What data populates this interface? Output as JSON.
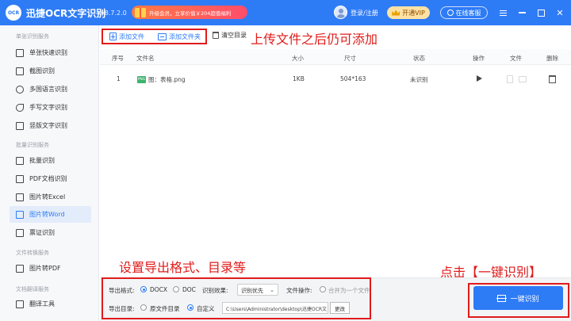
{
  "titlebar": {
    "logo": "OCR",
    "title": "迅捷OCR文字识别",
    "version": "v8.7.2.0",
    "promo": "升级会员，立享价值￥204超值福利",
    "login": "登录/注册",
    "vip": "开通VIP",
    "service": "在线客服"
  },
  "sidebar": {
    "groups": [
      {
        "title": "单张识别服务",
        "items": [
          {
            "label": "单张快速识别",
            "icon": "image-icon"
          },
          {
            "label": "截图识别",
            "icon": "crop-icon"
          },
          {
            "label": "多国语言识别",
            "icon": "globe-icon"
          },
          {
            "label": "手写文字识别",
            "icon": "pen-icon"
          },
          {
            "label": "竖版文字识别",
            "icon": "vertical-text-icon"
          }
        ]
      },
      {
        "title": "批量识别服务",
        "items": [
          {
            "label": "批量识别",
            "icon": "batch-icon"
          },
          {
            "label": "PDF文档识别",
            "icon": "pdf-icon"
          },
          {
            "label": "图片转Excel",
            "icon": "excel-icon"
          },
          {
            "label": "图片转Word",
            "icon": "word-icon",
            "active": true
          },
          {
            "label": "票证识别",
            "icon": "ticket-icon"
          }
        ]
      },
      {
        "title": "文件转换服务",
        "items": [
          {
            "label": "图片转PDF",
            "icon": "pdf-convert-icon"
          }
        ]
      },
      {
        "title": "文档翻译服务",
        "items": [
          {
            "label": "翻译工具",
            "icon": "translate-icon"
          }
        ]
      }
    ]
  },
  "toolbar": {
    "add_file": "添加文件",
    "add_folder": "添加文件夹",
    "clear": "清空目录"
  },
  "annotations": {
    "top": "上传文件之后仍可添加",
    "bottom": "设置导出格式、目录等",
    "right": "点击【一键识别】"
  },
  "table": {
    "headers": [
      "序号",
      "文件名",
      "大小",
      "尺寸",
      "状态",
      "操作",
      "文件",
      "删除"
    ],
    "rows": [
      {
        "index": "1",
        "name": "图：表格.png",
        "size": "1KB",
        "dimensions": "504*163",
        "status": "未识别"
      }
    ]
  },
  "settings": {
    "format_label": "导出格式:",
    "format_options": [
      "DOCX",
      "DOC"
    ],
    "format_selected": "DOCX",
    "effect_label": "识别效果:",
    "effect_value": "识别优先",
    "file_op_label": "文件操作:",
    "merge_label": "合并为一个文件",
    "dir_label": "导出目录:",
    "dir_options": [
      "原文件目录",
      "自定义"
    ],
    "dir_selected": "自定义",
    "path": "C:\\Users\\Administrator\\desktop\\迅捷OCR文",
    "change": "更改"
  },
  "ocr_button": "一键识别",
  "colors": {
    "accent": "#2e7bf6",
    "annotation": "#e01b1b"
  }
}
